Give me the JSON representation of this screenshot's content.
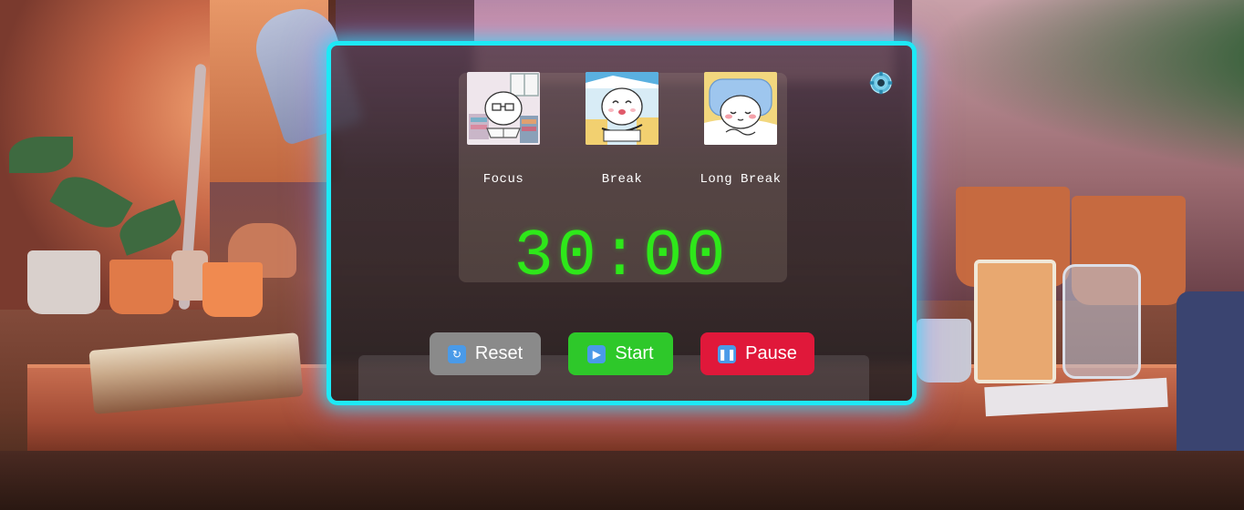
{
  "modes": [
    {
      "id": "focus",
      "label": "Focus",
      "icon": "studying-character-image"
    },
    {
      "id": "break",
      "label": "Break",
      "icon": "happy-character-image"
    },
    {
      "id": "long_break",
      "label": "Long Break",
      "icon": "sleeping-character-image"
    }
  ],
  "timer": {
    "display": "30:00"
  },
  "controls": {
    "reset_label": "Reset",
    "start_label": "Start",
    "pause_label": "Pause"
  },
  "settings": {
    "icon": "gear-icon"
  },
  "colors": {
    "panel_border": "#1de9f6",
    "timer_text": "#2ee81a",
    "reset_bg": "#8a8a8a",
    "start_bg": "#2ec82a",
    "pause_bg": "#e0183a"
  }
}
